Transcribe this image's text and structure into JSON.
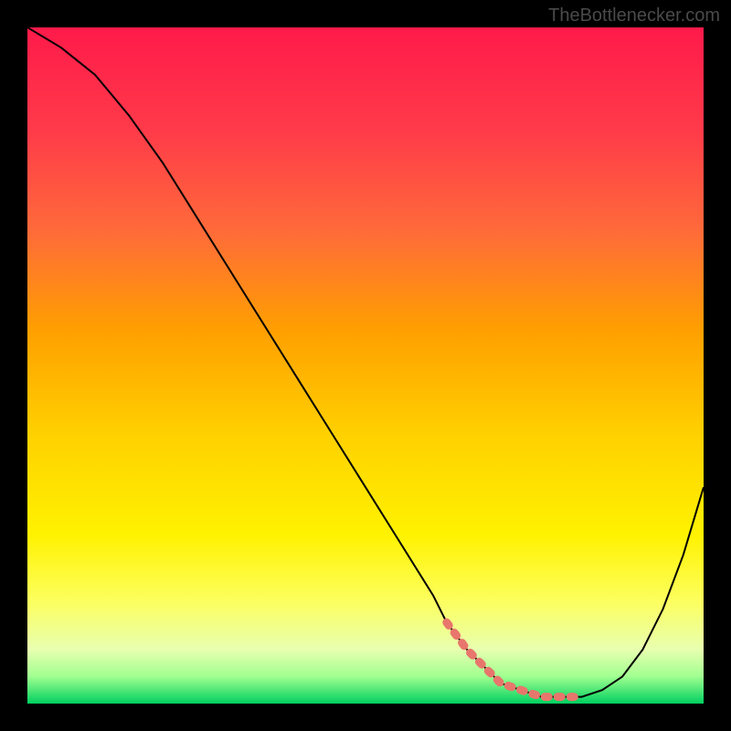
{
  "watermark": "TheBottlenecker.com",
  "chart_data": {
    "type": "line",
    "title": "",
    "xlabel": "",
    "ylabel": "",
    "xlim": [
      0,
      100
    ],
    "ylim": [
      0,
      100
    ],
    "series": [
      {
        "name": "curve",
        "x": [
          0,
          5,
          10,
          15,
          20,
          25,
          30,
          35,
          40,
          45,
          50,
          55,
          60,
          62,
          65,
          68,
          70,
          73,
          76,
          79,
          82,
          85,
          88,
          91,
          94,
          97,
          100
        ],
        "y": [
          100,
          97,
          93,
          87,
          80,
          72,
          64,
          56,
          48,
          40,
          32,
          24,
          16,
          12,
          8,
          5,
          3,
          2,
          1,
          1,
          1,
          2,
          4,
          8,
          14,
          22,
          32
        ]
      }
    ],
    "highlight_region": {
      "x_start": 62,
      "x_end": 82,
      "y": 1.5,
      "color": "#e8766c"
    },
    "gradient_stops": [
      {
        "offset": 0,
        "color": "#ff1a4a"
      },
      {
        "offset": 15,
        "color": "#ff3a4a"
      },
      {
        "offset": 30,
        "color": "#ff6a3a"
      },
      {
        "offset": 45,
        "color": "#ffa000"
      },
      {
        "offset": 60,
        "color": "#ffd000"
      },
      {
        "offset": 75,
        "color": "#fff200"
      },
      {
        "offset": 85,
        "color": "#fcff60"
      },
      {
        "offset": 92,
        "color": "#e8ffb0"
      },
      {
        "offset": 96,
        "color": "#a0ff90"
      },
      {
        "offset": 100,
        "color": "#00d060"
      }
    ]
  }
}
